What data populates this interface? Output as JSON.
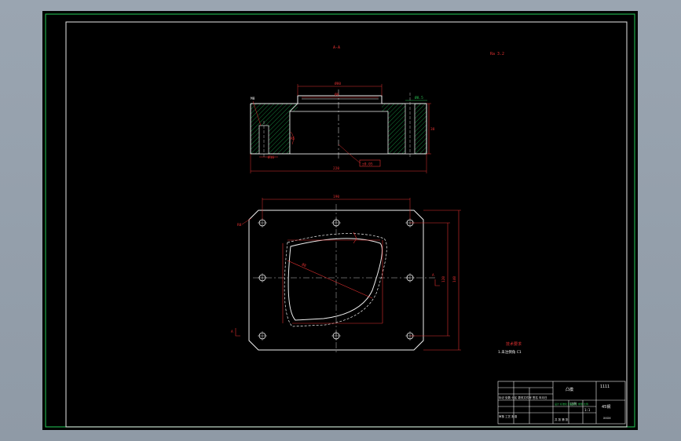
{
  "drawing": {
    "section_label": "A-A",
    "roughness_note": "Ra 3.2",
    "top_view": {
      "dim_top_width": "Ø80",
      "dim_center": "Ø0",
      "dim_right_height": "38",
      "dim_bottom_width": "220",
      "callout_box": "±0.05",
      "left_small": "M8",
      "bottom_small": "Ø16",
      "green_note": "Ø8.5",
      "dim_left_radius": "R5"
    },
    "plan_view": {
      "dim_top": "190",
      "dim_right_outer": "140",
      "dim_right_inner": "120",
      "corner_label": "R8",
      "diagonal_dim": "Ø8",
      "left_marker": "A",
      "right_marker": "A"
    },
    "tech_req": {
      "title": "技术要求",
      "line1": "1.未注倒角 C1"
    }
  },
  "title_block": {
    "part_name": "凸模",
    "drawing_no": "1111",
    "scale_label": "比例",
    "scale_value": "1:1",
    "material": "45钢",
    "school": "xxxx",
    "row1": "标记 处数 分区 更改文件号 签名 年月日",
    "row2": "设计 标准化 阶段标记 重量 比例",
    "row3": "审核 工艺 批准",
    "sheet": "共 张 第 张"
  }
}
